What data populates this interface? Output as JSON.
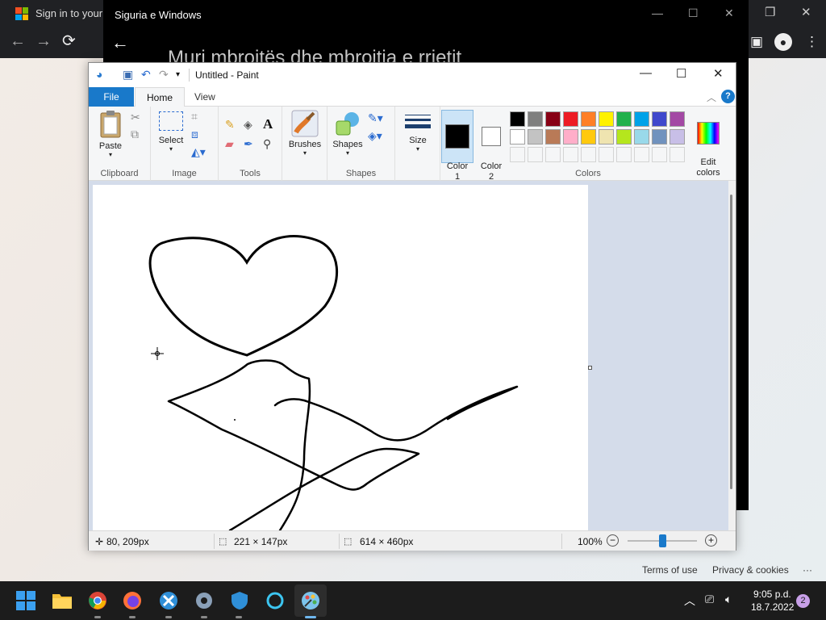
{
  "browser": {
    "tab_title": "Sign in to your a",
    "back": "←",
    "forward": "→",
    "reload": "⟳"
  },
  "security_window": {
    "title": "Siguria e Windows",
    "heading": "Muri mbrojtës dhe mbrojtja e rrjetit"
  },
  "paint": {
    "window_title": "Untitled - Paint",
    "tabs": [
      "File",
      "Home",
      "View"
    ],
    "clipboard": {
      "paste_label": "Paste",
      "group_label": "Clipboard"
    },
    "image": {
      "select_label": "Select",
      "group_label": "Image"
    },
    "tools": {
      "group_label": "Tools"
    },
    "brushes_label": "Brushes",
    "shapes": {
      "shapes_label": "Shapes",
      "group_label": "Shapes"
    },
    "size_label": "Size",
    "color1_label": "Color\n1",
    "color2_label": "Color\n2",
    "edit_colors_label": "Edit\ncolors",
    "colors_group_label": "Colors",
    "palette_row1": [
      "#000000",
      "#7f7f7f",
      "#880015",
      "#ed1c24",
      "#ff7f27",
      "#fff200",
      "#22b14c",
      "#00a2e8",
      "#3f48cc",
      "#a349a4"
    ],
    "palette_row2": [
      "#ffffff",
      "#c3c3c3",
      "#b97a57",
      "#ffaec9",
      "#ffc90e",
      "#efe4b0",
      "#b5e61d",
      "#99d9ea",
      "#7092be",
      "#c8bfe7"
    ],
    "color1": "#000000",
    "color2": "#ffffff",
    "status": {
      "cursor_pos": "80, 209px",
      "selection_size": "221 × 147px",
      "image_size": "614 × 460px",
      "zoom": "100%",
      "zoom_fraction": 0.5
    }
  },
  "bottom_links": {
    "terms": "Terms of use",
    "privacy": "Privacy & cookies",
    "more": "···"
  },
  "taskbar": {
    "time": "9:05 p.d.",
    "date": "18.7.2022",
    "notifications": "2"
  }
}
